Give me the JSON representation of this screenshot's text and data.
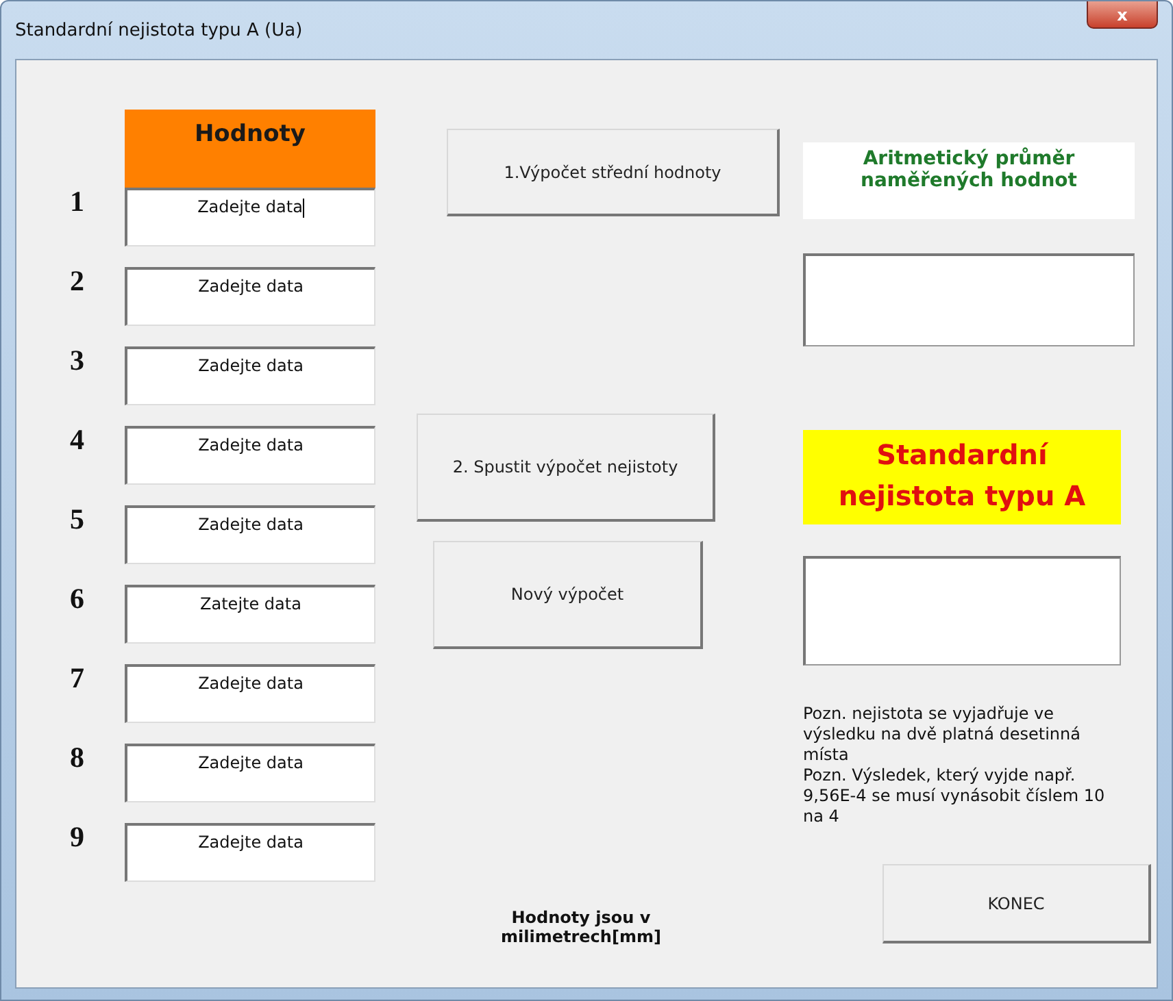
{
  "window": {
    "title": "Standardní nejistota typu A (Ua)",
    "close": "x"
  },
  "values_header": "Hodnoty",
  "inputs": [
    {
      "number": "1",
      "value": "Zadejte data",
      "focused": true
    },
    {
      "number": "2",
      "value": "Zadejte data",
      "focused": false
    },
    {
      "number": "3",
      "value": "Zadejte data",
      "focused": false
    },
    {
      "number": "4",
      "value": "Zadejte data",
      "focused": false
    },
    {
      "number": "5",
      "value": "Zadejte data",
      "focused": false
    },
    {
      "number": "6",
      "value": "Zatejte data",
      "focused": false
    },
    {
      "number": "7",
      "value": "Zadejte data",
      "focused": false
    },
    {
      "number": "8",
      "value": "Zadejte data",
      "focused": false
    },
    {
      "number": "9",
      "value": "Zadejte data",
      "focused": false
    }
  ],
  "buttons": {
    "mean": "1.Výpočet střední hodnoty",
    "uncertainty": "2. Spustit výpočet nejistoty",
    "new": "Nový výpočet",
    "end": "KONEC"
  },
  "units_label": "Hodnoty jsou v milimetrech[mm]",
  "mean_label": "Aritmetický průměr naměřených hodnot",
  "uncertainty_label": "Standardní nejistota typu A",
  "note": "Pozn. nejistota se vyjadřuje ve výsledku na dvě platná desetinná místa\nPozn. Výsledek, který vyjde např. 9,56E-4 se musí vynásobit číslem 10 na 4"
}
